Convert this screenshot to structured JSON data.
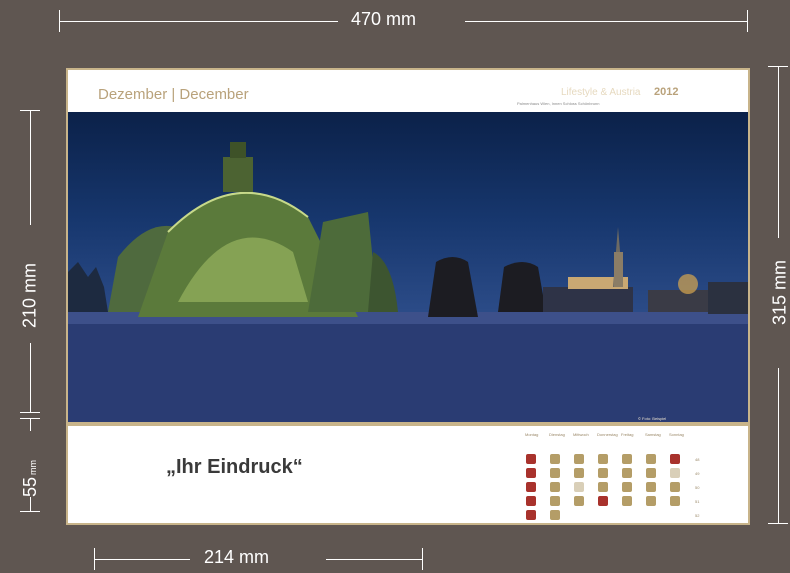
{
  "dimensions": {
    "top_width": "470 mm",
    "bottom_width": "214 mm",
    "left_height_main": "210 mm",
    "left_height_small": "55",
    "left_height_small_unit": "mm",
    "right_height": "315 mm"
  },
  "calendar": {
    "month_title": "Dezember | December",
    "brand": "Lifestyle & Austria",
    "year": "2012",
    "subtitle": "Palmenhaus Wien, Innen Schloss Schönbrunn",
    "photo_credit": "© Foto: Beispiel",
    "impression_text": "„Ihr Eindruck“",
    "grid_headers": [
      "Montag",
      "Dienstag",
      "Mittwoch",
      "Donnerstag",
      "Freitag",
      "Samstag",
      "Sonntag"
    ],
    "week_numbers": [
      "48",
      "49",
      "50",
      "51",
      "52"
    ],
    "colors": {
      "background": "#5f5651",
      "accent": "#c8b48a",
      "cell": "#b49d67",
      "holiday": "#a8322c"
    }
  }
}
